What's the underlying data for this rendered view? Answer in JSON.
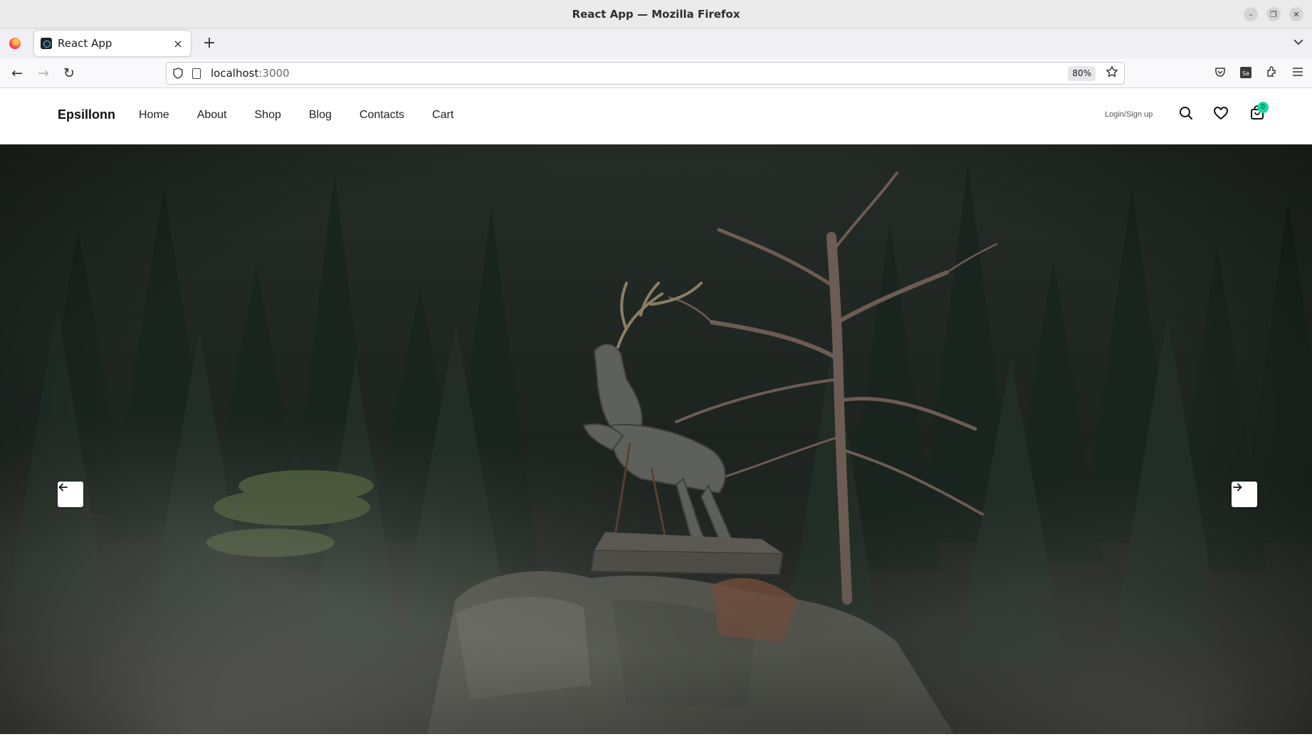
{
  "window": {
    "title": "React App — Mozilla Firefox",
    "controls": {
      "minimize": "–",
      "restore": "❐",
      "close": "✕"
    }
  },
  "browser": {
    "tab": {
      "title": "React App",
      "close_glyph": "×"
    },
    "new_tab_glyph": "+",
    "list_tabs_glyph": "⌵",
    "nav": {
      "back_glyph": "←",
      "forward_glyph": "→",
      "reload_glyph": "↻"
    },
    "url": {
      "host": "localhost",
      "port": ":3000"
    },
    "zoom": "80%",
    "icons": [
      "shield-icon",
      "page-icon",
      "bookmark-star-icon",
      "pocket-icon",
      "extension-se-icon",
      "extensions-icon",
      "menu-icon"
    ]
  },
  "site": {
    "brand": "Epsillonn",
    "menu": [
      {
        "label": "Home"
      },
      {
        "label": "About"
      },
      {
        "label": "Shop"
      },
      {
        "label": "Blog"
      },
      {
        "label": "Contacts"
      },
      {
        "label": "Cart"
      }
    ],
    "login": "Login/Sign up",
    "cart_count": "0",
    "accent_color": "#19d7a4"
  },
  "hero": {
    "image_alt": "Wooden deer statue on a rock in front of a dark forest with a bare tree",
    "prev_arrow": "←",
    "next_arrow": "→"
  }
}
